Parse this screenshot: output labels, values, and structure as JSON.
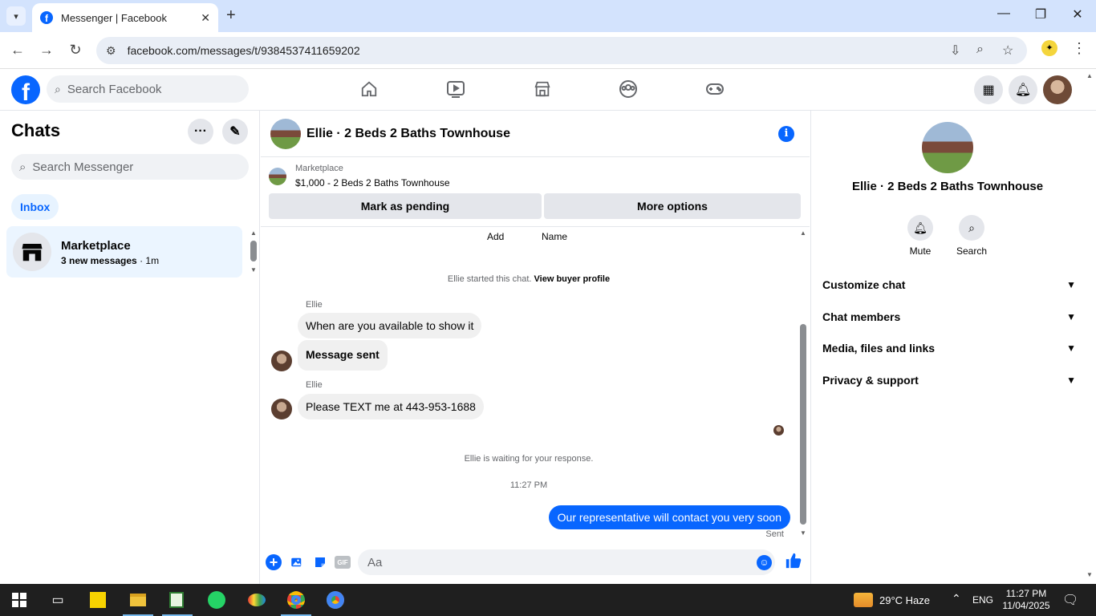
{
  "browser": {
    "tab_title": "Messenger | Facebook",
    "url": "facebook.com/messages/t/9384537411659202"
  },
  "fb": {
    "search_placeholder": "Search Facebook"
  },
  "chats": {
    "title": "Chats",
    "search_placeholder": "Search Messenger",
    "inbox_label": "Inbox",
    "items": [
      {
        "name": "Marketplace",
        "preview": "3 new messages",
        "time": "· 1m"
      }
    ]
  },
  "conversation": {
    "title": "Ellie · 2 Beds 2 Baths Townhouse",
    "marketplace_label": "Marketplace",
    "listing": "$1,000 - 2 Beds 2 Baths Townhouse",
    "mark_pending": "Mark as pending",
    "more_options": "More options",
    "top_actions": [
      "Add",
      "Name"
    ],
    "started_text": "Ellie started this chat.",
    "view_profile": "View buyer profile",
    "messages": [
      {
        "sender": "Ellie",
        "text": "When are you available to show it"
      },
      {
        "text": "Message sent"
      },
      {
        "sender": "Ellie",
        "text": "Please TEXT me at 443-953-1688"
      }
    ],
    "waiting_text": "Ellie is waiting for your response.",
    "timestamp": "11:27 PM",
    "outgoing": "Our representative will contact you very soon",
    "sent_label": "Sent",
    "composer_placeholder": "Aa"
  },
  "details": {
    "title": "Ellie · 2 Beds 2 Baths Townhouse",
    "mute_label": "Mute",
    "search_label": "Search",
    "sections": [
      "Customize chat",
      "Chat members",
      "Media, files and links",
      "Privacy & support"
    ]
  },
  "taskbar": {
    "weather": "29°C  Haze",
    "lang": "ENG",
    "time": "11:27 PM",
    "date": "11/04/2025"
  },
  "colors": {
    "accent": "#0866ff",
    "chrome_tabbar": "#d3e3fd",
    "selected_chat": "#ebf5ff"
  }
}
